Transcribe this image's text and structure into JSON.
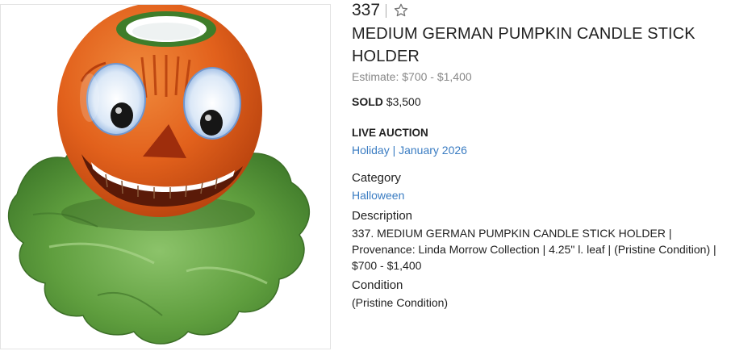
{
  "lot": {
    "number": "337",
    "title": "MEDIUM GERMAN PUMPKIN CANDLE STICK HOLDER",
    "estimate": "Estimate: $700 - $1,400",
    "sold_label": "SOLD",
    "sold_price": "$3,500"
  },
  "auction": {
    "heading": "LIVE AUCTION",
    "link": "Holiday | January 2026"
  },
  "category": {
    "heading": "Category",
    "value": "Halloween"
  },
  "description": {
    "heading": "Description",
    "text": "337. MEDIUM GERMAN PUMPKIN CANDLE STICK HOLDER | Provenance: Linda Morrow Collection | 4.25\" l. leaf | (Pristine Condition) | $700 - $1,400"
  },
  "condition": {
    "heading": "Condition",
    "text": "(Pristine Condition)"
  },
  "icons": {
    "favorite": "star-outline-icon"
  },
  "colors": {
    "link": "#3a7cc2",
    "muted": "#888888",
    "pumpkin": "#e4661f",
    "leaf": "#5a9a3a"
  }
}
